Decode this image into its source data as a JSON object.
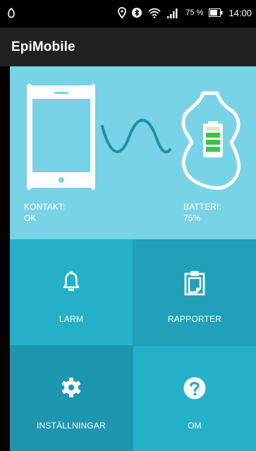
{
  "status_bar": {
    "battery_percent": "75 %",
    "time": "14:00",
    "icons": [
      "notification-icon",
      "location-icon",
      "bluetooth-icon",
      "wifi-icon",
      "signal-icon",
      "battery-icon"
    ]
  },
  "app_bar": {
    "title": "EpiMobile"
  },
  "hero": {
    "contact_label": "KONTAKT:",
    "contact_value": "OK",
    "battery_label": "BATTERI:",
    "battery_value": "75%",
    "battery_level": 0.75,
    "icons": [
      "phone-icon",
      "wave-icon",
      "sensor-device-icon",
      "battery-level-icon"
    ]
  },
  "tiles": [
    {
      "label": "LARM",
      "icon": "bell-icon"
    },
    {
      "label": "RAPPORTER",
      "icon": "clipboard-icon"
    },
    {
      "label": "INSTÄLLNINGAR",
      "icon": "gear-icon"
    },
    {
      "label": "OM",
      "icon": "help-icon"
    }
  ],
  "colors": {
    "hero_bg": "#78d3e6",
    "tile_light": "#25b0ca",
    "tile_mid": "#229fb9",
    "tile_dark": "#1e96ae",
    "wave": "#1e8fa8",
    "battery_fill": "#3cc44a",
    "app_bar_bg": "#202124"
  }
}
